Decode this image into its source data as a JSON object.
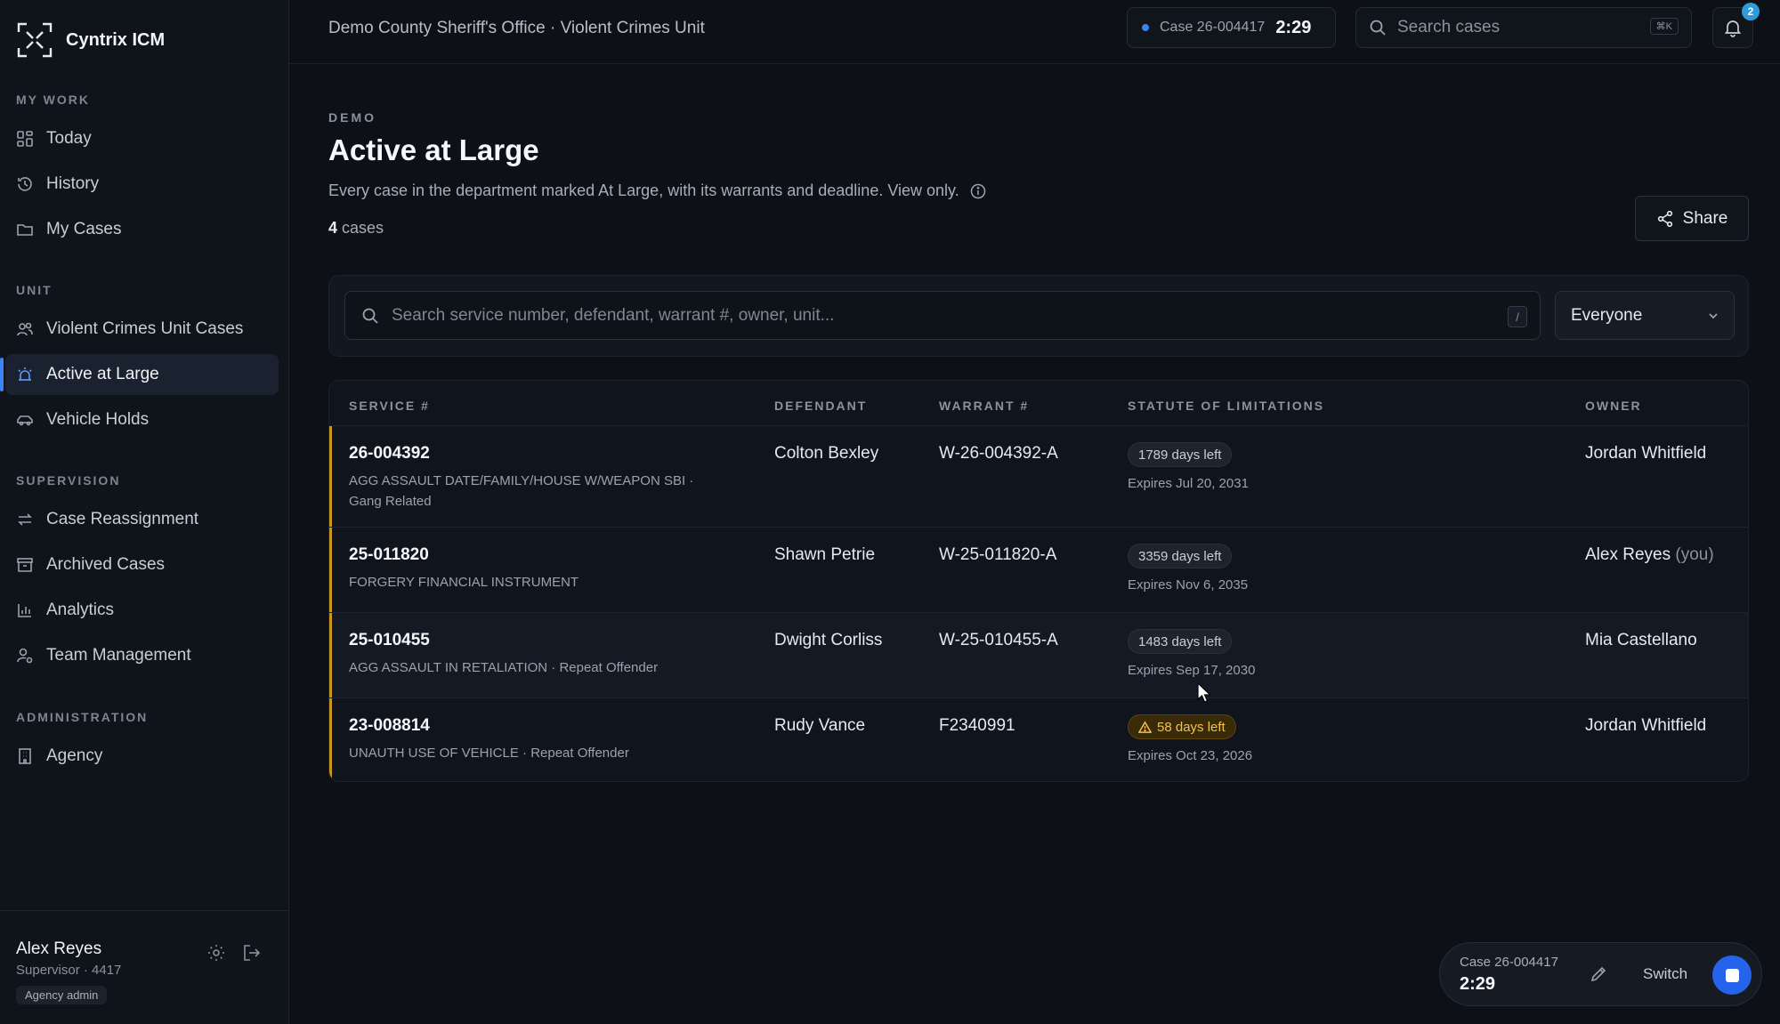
{
  "app": {
    "name": "Cyntrix ICM"
  },
  "sidebar": {
    "sections": [
      {
        "title": "MY WORK",
        "items": [
          {
            "label": "Today"
          },
          {
            "label": "History"
          },
          {
            "label": "My Cases"
          }
        ]
      },
      {
        "title": "UNIT",
        "items": [
          {
            "label": "Violent Crimes Unit Cases"
          },
          {
            "label": "Active at Large",
            "active": true
          },
          {
            "label": "Vehicle Holds"
          }
        ]
      },
      {
        "title": "SUPERVISION",
        "items": [
          {
            "label": "Case Reassignment"
          },
          {
            "label": "Archived Cases"
          },
          {
            "label": "Analytics"
          },
          {
            "label": "Team Management"
          }
        ]
      },
      {
        "title": "ADMINISTRATION",
        "items": [
          {
            "label": "Agency"
          }
        ]
      }
    ],
    "user": {
      "name": "Alex Reyes",
      "role": "Supervisor · 4417",
      "badge": "Agency admin"
    }
  },
  "header": {
    "org_title": "Demo County Sheriff's Office · Violent Crimes Unit",
    "timer": {
      "case": "Case 26-004417",
      "time": "2:29"
    },
    "search": {
      "placeholder": "Search cases",
      "shortcut": "⌘K"
    },
    "notifications": {
      "count": "2"
    }
  },
  "page": {
    "eyebrow": "DEMO",
    "title": "Active at Large",
    "description": "Every case in the department marked At Large, with its warrants and deadline. View only.",
    "count_number": "4",
    "count_label": "cases",
    "share_label": "Share"
  },
  "filters": {
    "search_placeholder": "Search service number, defendant, warrant #, owner, unit...",
    "shortcut": "/",
    "owner_select": "Everyone"
  },
  "table": {
    "columns": [
      "SERVICE #",
      "DEFENDANT",
      "WARRANT #",
      "STATUTE OF LIMITATIONS",
      "OWNER"
    ],
    "rows": [
      {
        "service": "26-004392",
        "offense": "AGG ASSAULT DATE/FAMILY/HOUSE W/WEAPON SBI · Gang Related",
        "defendant": "Colton Bexley",
        "warrant": "W-26-004392-A",
        "days_left": "1789 days left",
        "expires": "Expires Jul 20, 2031",
        "owner": "Jordan Whitfield",
        "owner_suffix": "",
        "warning": false
      },
      {
        "service": "25-011820",
        "offense": "FORGERY FINANCIAL INSTRUMENT",
        "defendant": "Shawn Petrie",
        "warrant": "W-25-011820-A",
        "days_left": "3359 days left",
        "expires": "Expires Nov 6, 2035",
        "owner": "Alex Reyes",
        "owner_suffix": "(you)",
        "warning": false
      },
      {
        "service": "25-010455",
        "offense": "AGG ASSAULT IN RETALIATION · Repeat Offender",
        "defendant": "Dwight Corliss",
        "warrant": "W-25-010455-A",
        "days_left": "1483 days left",
        "expires": "Expires Sep 17, 2030",
        "owner": "Mia Castellano",
        "owner_suffix": "",
        "warning": false
      },
      {
        "service": "23-008814",
        "offense": "UNAUTH USE OF VEHICLE · Repeat Offender",
        "defendant": "Rudy Vance",
        "warrant": "F2340991",
        "days_left": "58 days left",
        "expires": "Expires Oct 23, 2026",
        "owner": "Jordan Whitfield",
        "owner_suffix": "",
        "warning": true
      }
    ]
  },
  "floating_timer": {
    "case": "Case 26-004417",
    "time": "2:29",
    "switch_label": "Switch"
  },
  "colors": {
    "accent": "#3b82f6",
    "row_marker": "#c8961e",
    "warning": "#f2c14e"
  }
}
